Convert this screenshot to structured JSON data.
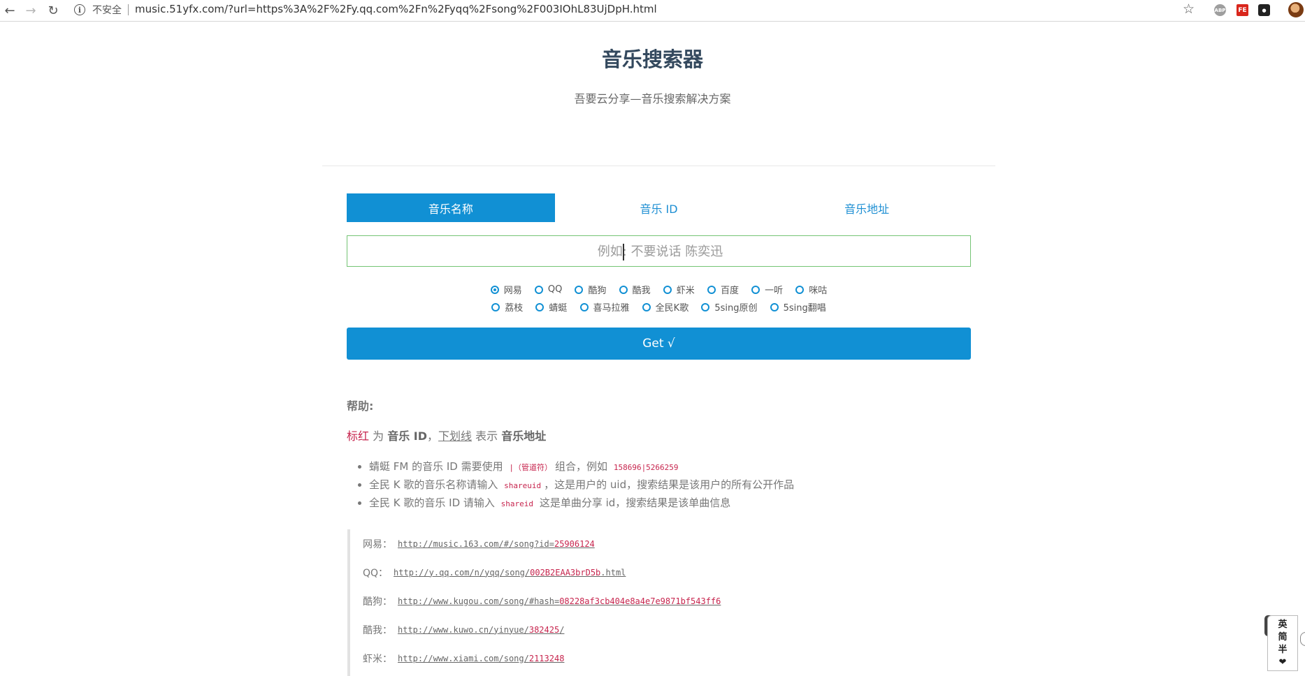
{
  "browser": {
    "insecure_label": "不安全",
    "url": "music.51yfx.com/?url=https%3A%2F%2Fy.qq.com%2Fn%2Fyqq%2Fsong%2F003IOhL83UjDpH.html"
  },
  "header": {
    "title": "音乐搜索器",
    "subtitle": "吾要云分享—音乐搜索解决方案"
  },
  "tabs": [
    {
      "label": "音乐名称",
      "active": true
    },
    {
      "label": "音乐 ID",
      "active": false
    },
    {
      "label": "音乐地址",
      "active": false
    }
  ],
  "search": {
    "placeholder": "例如: 不要说话 陈奕迅",
    "value": ""
  },
  "sources_row1": [
    "网易",
    "QQ",
    "酷狗",
    "酷我",
    "虾米",
    "百度",
    "一听",
    "咪咕"
  ],
  "sources_row2": [
    "荔枝",
    "蜻蜓",
    "喜马拉雅",
    "全民K歌",
    "5sing原创",
    "5sing翻唱"
  ],
  "selected_source": "网易",
  "get_button": "Get √",
  "help": {
    "title": "帮助:",
    "legend": {
      "red_word": "标红",
      "is1": "为",
      "id_word": "音乐 ID",
      "underline_word": "下划线",
      "is2": "表示",
      "url_word": "音乐地址"
    },
    "tips": [
      {
        "pre": "蜻蜓 FM 的音乐 ID 需要使用",
        "code": "|（管道符）",
        "post": "组合，例如",
        "code2": "158696|5266259"
      },
      {
        "pre": "全民 K 歌的音乐名称请输入",
        "code": "shareuid",
        "post": "，这是用户的 uid，搜索结果是该用户的所有公开作品",
        "code2": ""
      },
      {
        "pre": "全民 K 歌的音乐 ID 请输入",
        "code": "shareid",
        "post": "这是单曲分享 id，搜索结果是该单曲信息",
        "code2": ""
      }
    ],
    "examples": [
      {
        "label": "网易：",
        "prefix": "http://music.163.com/#/song?id=",
        "id": "25906124",
        "suffix": ""
      },
      {
        "label": "QQ：",
        "prefix": "http://y.qq.com/n/yqq/song/",
        "id": "002B2EAA3brD5b",
        "suffix": ".html"
      },
      {
        "label": "酷狗：",
        "prefix": "http://www.kugou.com/song/#hash=",
        "id": "08228af3cb404e8a4e7e9871bf543ff6",
        "suffix": ""
      },
      {
        "label": "酷我：",
        "prefix": "http://www.kuwo.cn/yinyue/",
        "id": "382425",
        "suffix": "/"
      },
      {
        "label": "虾米：",
        "prefix": "http://www.xiami.com/song/",
        "id": "2113248",
        "suffix": ""
      }
    ]
  },
  "ime": {
    "lines": [
      "英",
      "简",
      "半"
    ]
  }
}
